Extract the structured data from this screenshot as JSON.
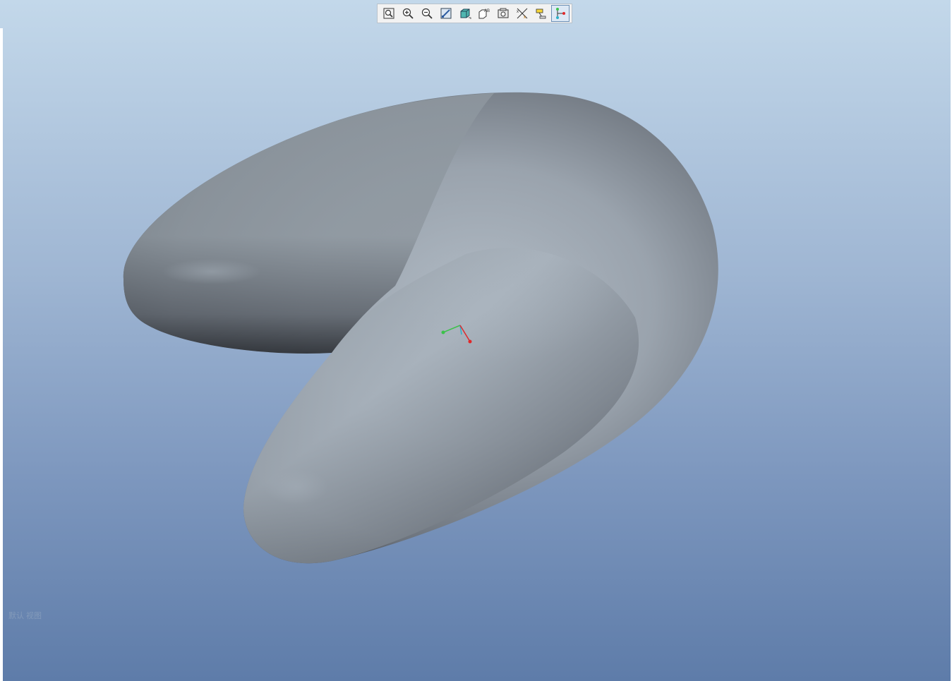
{
  "app": {
    "view_label": "默认 视图"
  },
  "toolbar": {
    "buttons": [
      {
        "name": "refit",
        "icon": "zoom-fit-icon"
      },
      {
        "name": "zoom-in",
        "icon": "zoom-in-icon"
      },
      {
        "name": "zoom-out",
        "icon": "zoom-out-icon"
      },
      {
        "name": "repaint",
        "icon": "repaint-icon"
      },
      {
        "name": "display-style",
        "icon": "shaded-cube-icon"
      },
      {
        "name": "saved-views",
        "icon": "saved-views-icon"
      },
      {
        "name": "view-manager",
        "icon": "view-manager-icon"
      },
      {
        "name": "datum-display",
        "icon": "datum-display-icon"
      },
      {
        "name": "annotation-display",
        "icon": "annotation-display-icon"
      },
      {
        "name": "spin-center",
        "icon": "spin-center-icon",
        "active": true
      }
    ]
  },
  "colors": {
    "background_top": "#c3d8ea",
    "background_bottom": "#5e7ca9",
    "model_light": "#b0bac4",
    "model_dark": "#2b2f35",
    "axis_x": "#e0282a",
    "axis_y": "#3cc24a",
    "axis_z": "#2bb0c8"
  }
}
